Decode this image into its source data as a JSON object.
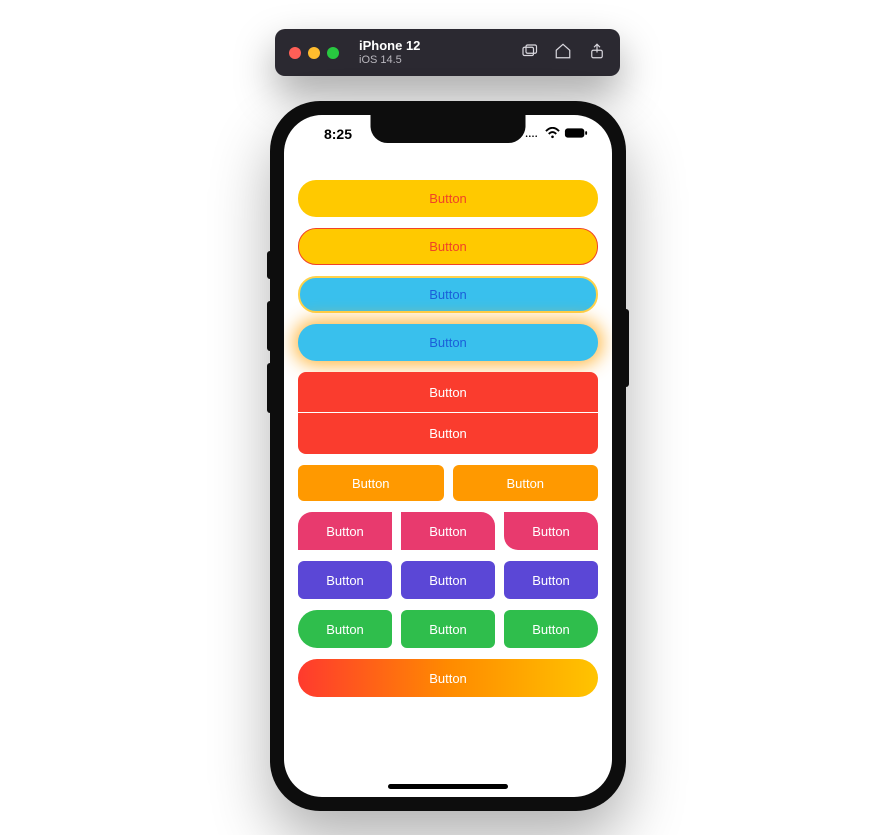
{
  "mac_window": {
    "title": "iPhone 12",
    "subtitle": "iOS 14.5"
  },
  "status_bar": {
    "time": "8:25"
  },
  "buttons": {
    "yellow1": "Button",
    "yellow2": "Button",
    "sky1": "Button",
    "sky2": "Button",
    "red1": "Button",
    "red2": "Button",
    "orange1": "Button",
    "orange2": "Button",
    "pink1": "Button",
    "pink2": "Button",
    "pink3": "Button",
    "purple1": "Button",
    "purple2": "Button",
    "purple3": "Button",
    "green1": "Button",
    "green2": "Button",
    "green3": "Button",
    "gradient": "Button"
  }
}
